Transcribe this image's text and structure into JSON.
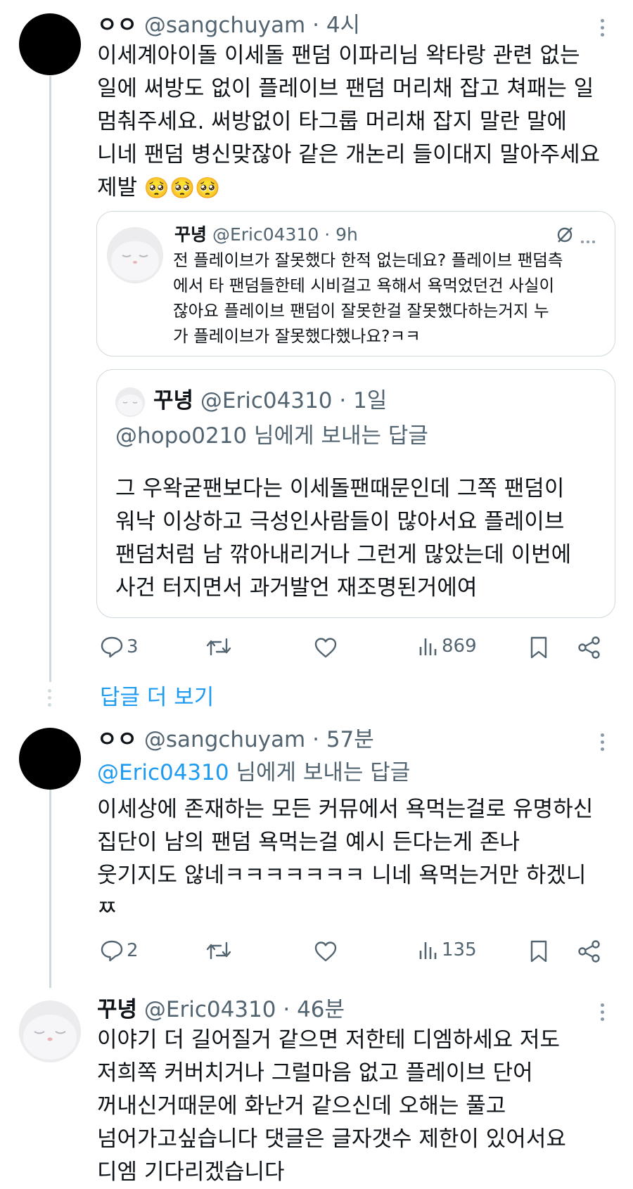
{
  "tweet1": {
    "name": "ㅇㅇ",
    "handle": "@sangchuyam",
    "time": "· 4시",
    "lines": [
      "이세계아이돌 이세돌 팬덤 이파리님 왁타랑 관련 없는",
      "일에 써방도 없이 플레이브 팬덤 머리채 잡고 쳐패는 일",
      "멈춰주세요. 써방없이 타그룹 머리채 잡지 말란 말에",
      "니네 팬덤 병신맞잖아 같은 개논리 들이대지 말아주세요",
      "제발"
    ],
    "emoji": "🥺🥺🥺",
    "quote1": {
      "name": "꾸녕",
      "handle": "@Eric04310",
      "time": "· 9h",
      "lines": [
        "전 플레이브가 잘못했다 한적 없는데요? 플레이브 팬덤측",
        "에서 타 팬덤들한테 시비걸고 욕해서 욕먹었던건 사실이",
        "잖아요 플레이브 팬덤이 잘못한걸 잘못했다하는거지 누",
        "가 플레이브가 잘못했다했나요?ㅋㅋ"
      ]
    },
    "quote2": {
      "name": "꾸녕",
      "handle": "@Eric04310",
      "time": "· 1일",
      "reply_to_handle": "@hopo0210",
      "reply_to_suffix": " 님에게 보내는 답글",
      "lines": [
        "그 우왁굳팬보다는 이세돌팬때문인데 그쪽 팬덤이",
        "워낙 이상하고 극성인사람들이 많아서요 플레이브",
        "팬덤처럼 남 깎아내리거나 그런게 많았는데 이번에",
        "사건 터지면서 과거발언 재조명된거에여"
      ]
    },
    "actions": {
      "replies": "3",
      "views": "869"
    }
  },
  "show_more": "답글 더 보기",
  "tweet2": {
    "name": "ㅇㅇ",
    "handle": "@sangchuyam",
    "time": "· 57분",
    "reply_to_handle": "@Eric04310",
    "reply_to_suffix": " 님에게 보내는 답글",
    "lines": [
      "이세상에 존재하는 모든 커뮤에서 욕먹는걸로 유명하신",
      "집단이 남의 팬덤 욕먹는걸 예시 든다는게 존나",
      "웃기지도 않네ㅋㅋㅋㅋㅋㅋㅋ 니네 욕먹는거만 하겠니",
      "ㅉ"
    ],
    "actions": {
      "replies": "2",
      "views": "135"
    }
  },
  "tweet3": {
    "name": "꾸녕",
    "handle": "@Eric04310",
    "time": "· 46분",
    "lines": [
      "이야기 더 길어질거 같으면 저한테 디엠하세요 저도",
      "저희쪽 커버치거나 그럴마음 없고 플레이브 단어",
      "꺼내신거때문에 화난거 같으신데 오해는 풀고",
      "넘어가고싶습니다 댓글은 글자갯수 제한이 있어서요",
      "디엠 기다리겠습니다"
    ]
  },
  "colors": {
    "accent": "#1d9bf0",
    "muted": "#536471",
    "border": "#cfd9de"
  },
  "icons": [
    "more-icon",
    "reply-icon",
    "retweet-icon",
    "like-icon",
    "views-icon",
    "bookmark-icon",
    "share-icon",
    "grok-icon",
    "cat-avatar"
  ]
}
